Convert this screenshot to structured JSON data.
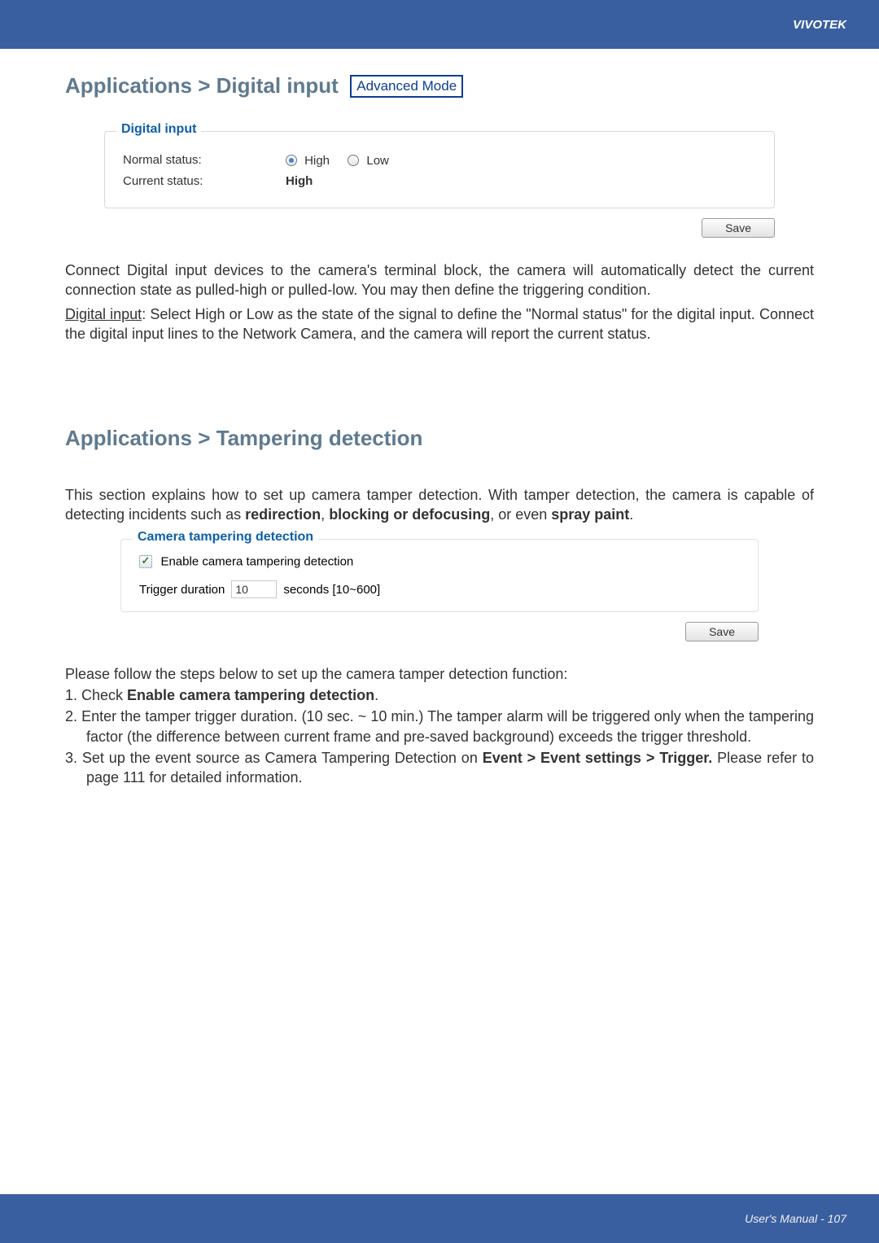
{
  "brand": "VIVOTEK",
  "section1": {
    "heading": "Applications > Digital input",
    "badge": "Advanced Mode",
    "fieldset_legend": "Digital input",
    "normal_label": "Normal status:",
    "radio_high": "High",
    "radio_low": "Low",
    "current_label": "Current status:",
    "current_value": "High",
    "save_label": "Save",
    "para1": "Connect Digital input devices to the camera's terminal block, the camera will automatically detect the current connection state as pulled-high or pulled-low. You may then define the triggering condition.",
    "para2_under": "Digital input",
    "para2_rest": ": Select High or Low as the state of the signal to define the \"Normal status\" for the digital input. Connect the digital input lines to the Network Camera, and the camera will report the current status."
  },
  "section2": {
    "heading": "Applications > Tampering detection",
    "intro_pre": "This section explains how to set up camera tamper detection. With tamper detection, the camera is capable of detecting incidents such as ",
    "bold1": "redirection",
    "mid1": ", ",
    "bold2": "blocking or defocusing",
    "mid2": ", or even ",
    "bold3": "spray paint",
    "intro_post": ".",
    "fieldset_legend": "Camera tampering detection",
    "cb_label": "Enable camera tampering detection",
    "trigger_label": "Trigger duration",
    "trigger_value": "10",
    "trigger_suffix": "seconds [10~600]",
    "save_label": "Save",
    "steps_intro": "Please follow the steps below to set up the camera tamper detection function:",
    "step1_pre": "1. Check ",
    "step1_bold": "Enable camera tampering detection",
    "step1_post": ".",
    "step2": "2. Enter the tamper trigger duration. (10 sec. ~ 10 min.) The tamper alarm will be triggered only when the tampering factor (the difference between current frame and pre-saved background) exceeds the trigger threshold.",
    "step3_pre": "3. Set up the event source as Camera Tampering Detection on ",
    "step3_bold": "Event > Event settings > Trigger.",
    "step3_post": " Please refer to page 111 for detailed information."
  },
  "footer": "User's Manual - 107"
}
